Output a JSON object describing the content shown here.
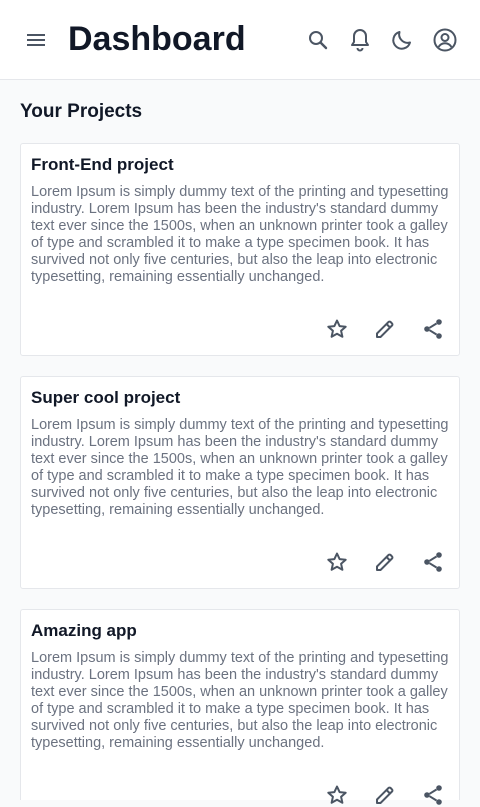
{
  "header": {
    "title": "Dashboard",
    "icons": [
      "menu-icon",
      "search-icon",
      "bell-icon",
      "moon-icon",
      "account-circle-icon"
    ]
  },
  "section_title": "Your Projects",
  "projects": [
    {
      "title": "Front-End project",
      "description": "Lorem Ipsum is simply dummy text of the printing and typesetting industry. Lorem Ipsum has been the industry's standard dummy text ever since the 1500s, when an unknown printer took a galley of type and scrambled it to make a type specimen book. It has survived not only five centuries, but also the leap into electronic typesetting, remaining essentially unchanged."
    },
    {
      "title": "Super cool project",
      "description": "Lorem Ipsum is simply dummy text of the printing and typesetting industry. Lorem Ipsum has been the industry's standard dummy text ever since the 1500s, when an unknown printer took a galley of type and scrambled it to make a type specimen book. It has survived not only five centuries, but also the leap into electronic typesetting, remaining essentially unchanged."
    },
    {
      "title": "Amazing app",
      "description": "Lorem Ipsum is simply dummy text of the printing and typesetting industry. Lorem Ipsum has been the industry's standard dummy text ever since the 1500s, when an unknown printer took a galley of type and scrambled it to make a type specimen book. It has survived not only five centuries, but also the leap into electronic typesetting, remaining essentially unchanged."
    }
  ],
  "card_actions": [
    "star-outline-icon",
    "edit-pencil-icon",
    "share-icon"
  ],
  "colors": {
    "background": "#f9fafb",
    "surface": "#ffffff",
    "text_primary": "#111827",
    "text_secondary": "#6b7280",
    "icon": "#4b5563",
    "border": "#e5e7eb"
  }
}
